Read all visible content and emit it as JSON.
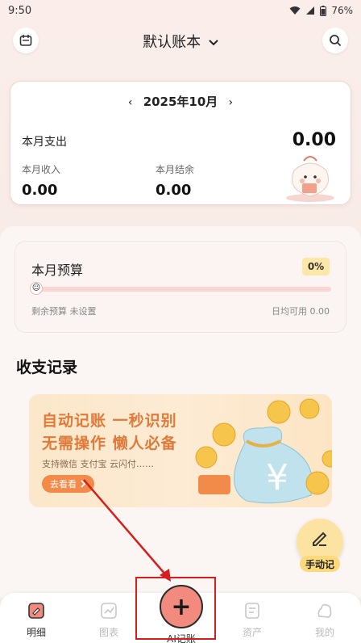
{
  "status_bar": {
    "time": "9:50",
    "battery": "76%"
  },
  "header": {
    "title": "默认账本"
  },
  "summary": {
    "month": "2025年10月",
    "expense_label": "本月支出",
    "expense_value": "0.00",
    "income_label": "本月收入",
    "income_value": "0.00",
    "balance_label": "本月结余",
    "balance_value": "0.00"
  },
  "budget": {
    "title": "本月预算",
    "percent": "0%",
    "progress_fraction": 0,
    "remaining": "剩余预算 未设置",
    "daily": "日均可用 0.00"
  },
  "records": {
    "title": "收支记录"
  },
  "banner": {
    "line1": "自动记账 一秒识别",
    "line2": "无需操作 懒人必备",
    "sub": "支持微信 支付宝 云闪付……",
    "button": "去看看"
  },
  "fab": {
    "label": "手动记"
  },
  "tabs": [
    {
      "label": "明细",
      "icon": "ledger-icon"
    },
    {
      "label": "图表",
      "icon": "chart-icon"
    },
    {
      "label": "AI记账",
      "icon": "plus-icon"
    },
    {
      "label": "资产",
      "icon": "asset-icon"
    },
    {
      "label": "我的",
      "icon": "profile-icon"
    }
  ],
  "colors": {
    "accent": "#f28b7e",
    "banner_text": "#e07a3a",
    "highlight": "#d61e1e"
  }
}
